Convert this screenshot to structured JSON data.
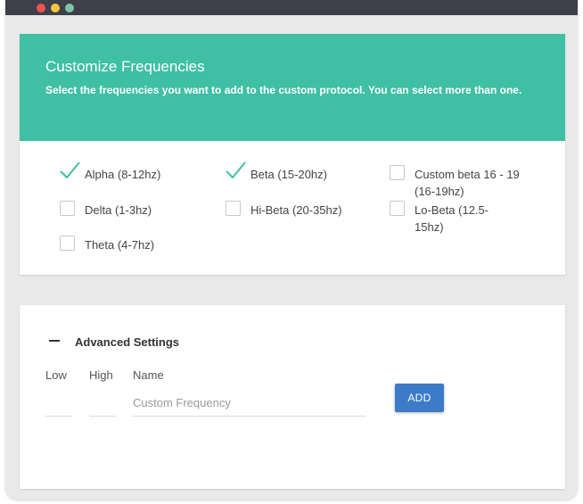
{
  "colors": {
    "header_bg": "#3fbfa3",
    "check": "#3fbfa3",
    "button_bg": "#3b7bc8",
    "dot_red": "#ef5350",
    "dot_yellow": "#f5c542",
    "dot_green": "#7fc4a8"
  },
  "header": {
    "title": "Customize Frequencies",
    "description": "Select the frequencies you want to add to the custom protocol. You can select more than one."
  },
  "frequencies": [
    {
      "label": "Alpha (8-12hz)",
      "checked": true
    },
    {
      "label": "Beta (15-20hz)",
      "checked": true
    },
    {
      "label": "Custom beta 16 - 19 (16-19hz)",
      "checked": false
    },
    {
      "label": "Delta (1-3hz)",
      "checked": false
    },
    {
      "label": "Hi-Beta (20-35hz)",
      "checked": false
    },
    {
      "label": "Lo-Beta (12.5-15hz)",
      "checked": false
    },
    {
      "label": "Theta (4-7hz)",
      "checked": false
    }
  ],
  "advanced": {
    "title": "Advanced Settings",
    "low_label": "Low",
    "high_label": "High",
    "name_label": "Name",
    "low_value": "",
    "high_value": "",
    "name_value": "",
    "name_placeholder": "Custom Frequency",
    "add_label": "ADD"
  }
}
